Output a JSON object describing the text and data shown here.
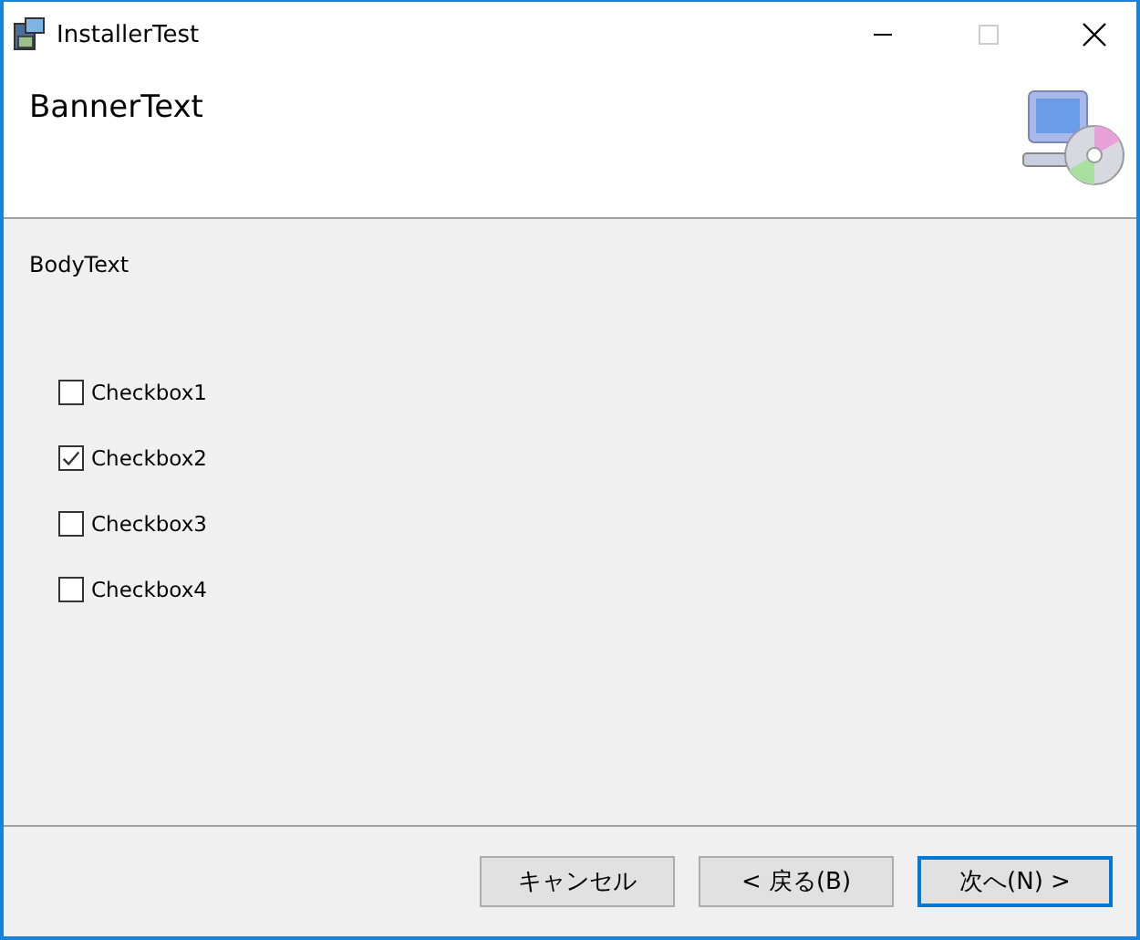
{
  "window": {
    "title": "InstallerTest"
  },
  "banner": {
    "title": "BannerText"
  },
  "body": {
    "text": "BodyText"
  },
  "checkboxes": [
    {
      "label": "Checkbox1",
      "checked": false
    },
    {
      "label": "Checkbox2",
      "checked": true
    },
    {
      "label": "Checkbox3",
      "checked": false
    },
    {
      "label": "Checkbox4",
      "checked": false
    }
  ],
  "buttons": [
    {
      "label": "キャンセル",
      "default": false
    },
    {
      "label": "< 戻る(B)",
      "default": false
    },
    {
      "label": "次へ(N) >",
      "default": true
    }
  ]
}
